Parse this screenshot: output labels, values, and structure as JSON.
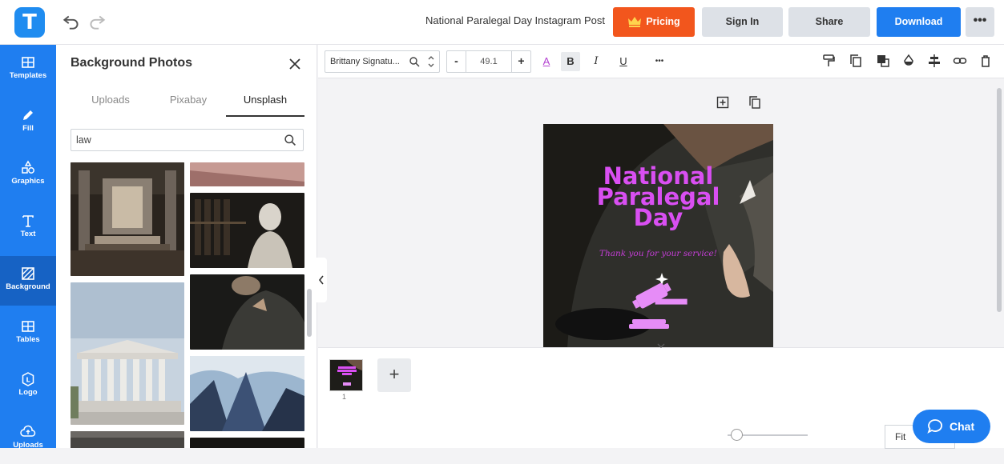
{
  "header": {
    "logo_letter": "T",
    "document_title": "National Paralegal Day Instagram Post",
    "pricing_label": "Pricing",
    "signin_label": "Sign In",
    "share_label": "Share",
    "download_label": "Download",
    "more_label": "•••"
  },
  "rail": {
    "items": [
      {
        "label": "Templates"
      },
      {
        "label": "Fill"
      },
      {
        "label": "Graphics"
      },
      {
        "label": "Text"
      },
      {
        "label": "Background"
      },
      {
        "label": "Tables"
      },
      {
        "label": "Logo"
      },
      {
        "label": "Uploads"
      }
    ],
    "active": "Background"
  },
  "panel": {
    "title": "Background Photos",
    "tabs": [
      "Uploads",
      "Pixabay",
      "Unsplash"
    ],
    "active_tab": "Unsplash",
    "search_value": "law"
  },
  "toolbar": {
    "font_name": "Brittany Signatu...",
    "font_size": "49.1",
    "minus_label": "-",
    "plus_label": "+",
    "bold_label": "B",
    "italic_label": "I",
    "underline_label": "U",
    "color_label": "A",
    "more_label": "•••"
  },
  "design": {
    "title_lines": [
      "National",
      "Paralegal",
      "Day"
    ],
    "script_text": "Thank you for your service!",
    "title_color": "#d94ff2"
  },
  "pages": {
    "page_number": "1",
    "add_label": "+"
  },
  "footer": {
    "fit_label": "Fit",
    "chat_label": "Chat"
  },
  "colors": {
    "brand_blue": "#1f7ef0",
    "pricing_orange": "#f2561d"
  }
}
